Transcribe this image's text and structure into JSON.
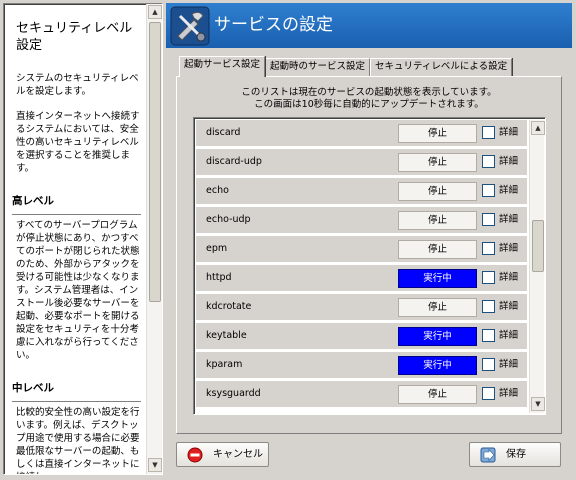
{
  "help": {
    "title": "セキュリティレベル設定",
    "paragraphs": [
      "システムのセキュリティレベルを設定します。",
      "直接インターネットへ接続するシステムにおいては、安全性の高いセキュリティレベルを選択することを推奨します。"
    ],
    "sections": [
      {
        "heading": "高レベル",
        "text": "すべてのサーバープログラムが停止状態にあり、かつすべてのポートが閉じられた状態のため、外部からアタックを受ける可能性は少なくなります。システム管理者は、インストール後必要なサーバーを起動、必要なポートを開ける設定をセキュリティを十分考慮に入れながら行ってください。"
      },
      {
        "heading": "中レベル",
        "text": "比較的安全性の高い設定を行います。例えば、デスクトップ用途で使用する場合に必要最低限なサーバーの起動、もしくは直接インターネットに接続し"
      }
    ]
  },
  "header": {
    "title": "サービスの設定",
    "logo_icon": "tools-logo-icon"
  },
  "tabs": [
    {
      "label": "起動サービス設定",
      "active": true
    },
    {
      "label": "起動時のサービス設定",
      "active": false
    },
    {
      "label": "セキュリティレベルによる設定",
      "active": false
    }
  ],
  "info": {
    "line1": "このリストは現在のサービスの起動状態を表示しています。",
    "line2": "この画面は10秒毎に自動的にアップデートされます。"
  },
  "services": [
    {
      "name": "discard",
      "status": "停止",
      "running": false,
      "detail": "詳細",
      "checked": false
    },
    {
      "name": "discard-udp",
      "status": "停止",
      "running": false,
      "detail": "詳細",
      "checked": false
    },
    {
      "name": "echo",
      "status": "停止",
      "running": false,
      "detail": "詳細",
      "checked": false
    },
    {
      "name": "echo-udp",
      "status": "停止",
      "running": false,
      "detail": "詳細",
      "checked": false
    },
    {
      "name": "epm",
      "status": "停止",
      "running": false,
      "detail": "詳細",
      "checked": false
    },
    {
      "name": "httpd",
      "status": "実行中",
      "running": true,
      "detail": "詳細",
      "checked": false
    },
    {
      "name": "kdcrotate",
      "status": "停止",
      "running": false,
      "detail": "詳細",
      "checked": false
    },
    {
      "name": "keytable",
      "status": "実行中",
      "running": true,
      "detail": "詳細",
      "checked": false
    },
    {
      "name": "kparam",
      "status": "実行中",
      "running": true,
      "detail": "詳細",
      "checked": false
    },
    {
      "name": "ksysguardd",
      "status": "停止",
      "running": false,
      "detail": "詳細",
      "checked": false
    }
  ],
  "buttons": {
    "cancel": {
      "label": "キャンセル",
      "icon": "cancel-icon"
    },
    "save": {
      "label": "保存",
      "icon": "save-arrow-icon"
    }
  },
  "colors": {
    "header_bg": "#2a76c6",
    "running_bg": "#0000ff",
    "stopped_bg": "#f4f3f0",
    "window_bg": "#d6d3ce"
  }
}
